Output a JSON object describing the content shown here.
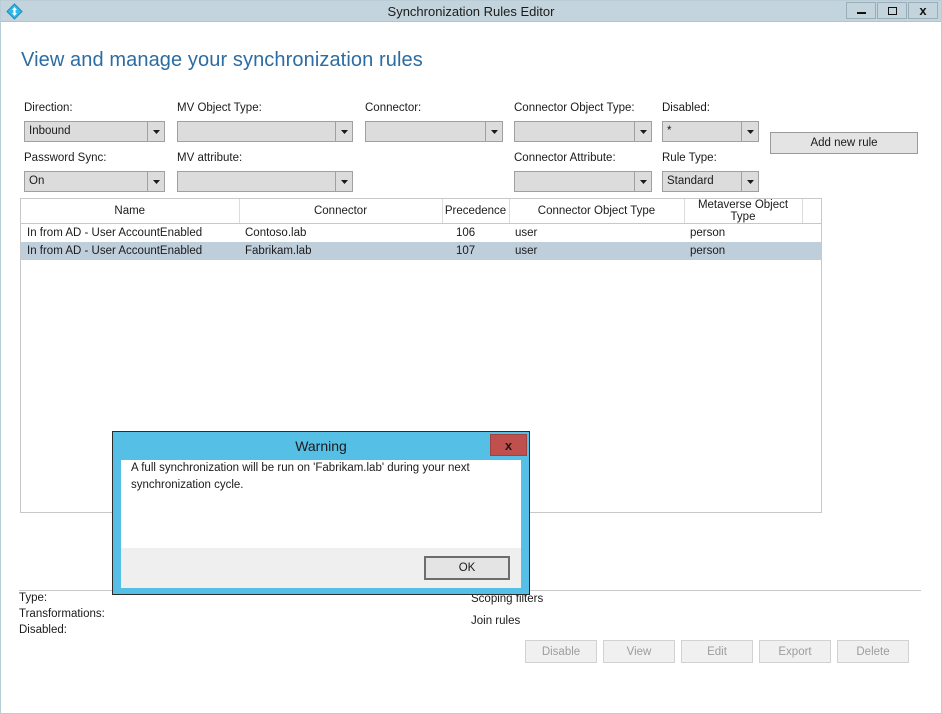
{
  "window": {
    "title": "Synchronization Rules Editor",
    "icon": "sync-diamond-icon",
    "controls": {
      "minimize": "minimize-icon",
      "maximize": "maximize-icon",
      "close": "close-icon",
      "close_label": "x"
    }
  },
  "page": {
    "heading": "View and manage your synchronization rules"
  },
  "filters": {
    "direction": {
      "label": "Direction:",
      "value": "Inbound"
    },
    "mv_object_type": {
      "label": "MV Object Type:",
      "value": ""
    },
    "connector": {
      "label": "Connector:",
      "value": ""
    },
    "connector_object_type": {
      "label": "Connector Object Type:",
      "value": ""
    },
    "disabled": {
      "label": "Disabled:",
      "value": "*"
    },
    "password_sync": {
      "label": "Password Sync:",
      "value": "On"
    },
    "mv_attribute": {
      "label": "MV attribute:",
      "value": ""
    },
    "connector_attribute": {
      "label": "Connector Attribute:",
      "value": ""
    },
    "rule_type": {
      "label": "Rule Type:",
      "value": "Standard"
    }
  },
  "toolbar": {
    "add_new_rule": "Add new rule"
  },
  "table": {
    "columns": [
      "Name",
      "Connector",
      "Precedence",
      "Connector Object Type",
      "Metaverse Object Type"
    ],
    "rows": [
      {
        "name": "In from AD - User AccountEnabled",
        "connector": "Contoso.lab",
        "precedence": "106",
        "connector_object_type": "user",
        "metaverse_object_type": "person",
        "selected": false
      },
      {
        "name": "In from AD - User AccountEnabled",
        "connector": "Fabrikam.lab",
        "precedence": "107",
        "connector_object_type": "user",
        "metaverse_object_type": "person",
        "selected": true
      }
    ]
  },
  "detail": {
    "type_label": "Type:",
    "transformations_label": "Transformations:",
    "disabled_label": "Disabled:",
    "scoping_filters_label": "Scoping filters",
    "join_rules_label": "Join rules"
  },
  "actions": [
    {
      "label": "Disable",
      "name": "disable-button"
    },
    {
      "label": "View",
      "name": "view-button"
    },
    {
      "label": "Edit",
      "name": "edit-button"
    },
    {
      "label": "Export",
      "name": "export-button"
    },
    {
      "label": "Delete",
      "name": "delete-button"
    }
  ],
  "dialog": {
    "title": "Warning",
    "close_label": "x",
    "message": "A full synchronization will be run on 'Fabrikam.lab' during your next synchronization cycle.",
    "ok_label": "OK"
  },
  "colors": {
    "titlebar": "#c3d4dc",
    "heading": "#2b6ca3",
    "dialog_border": "#56bfe6",
    "dialog_close": "#c0504d",
    "row_selected": "#bfcedb",
    "combo_bg": "#dcdcdc"
  }
}
